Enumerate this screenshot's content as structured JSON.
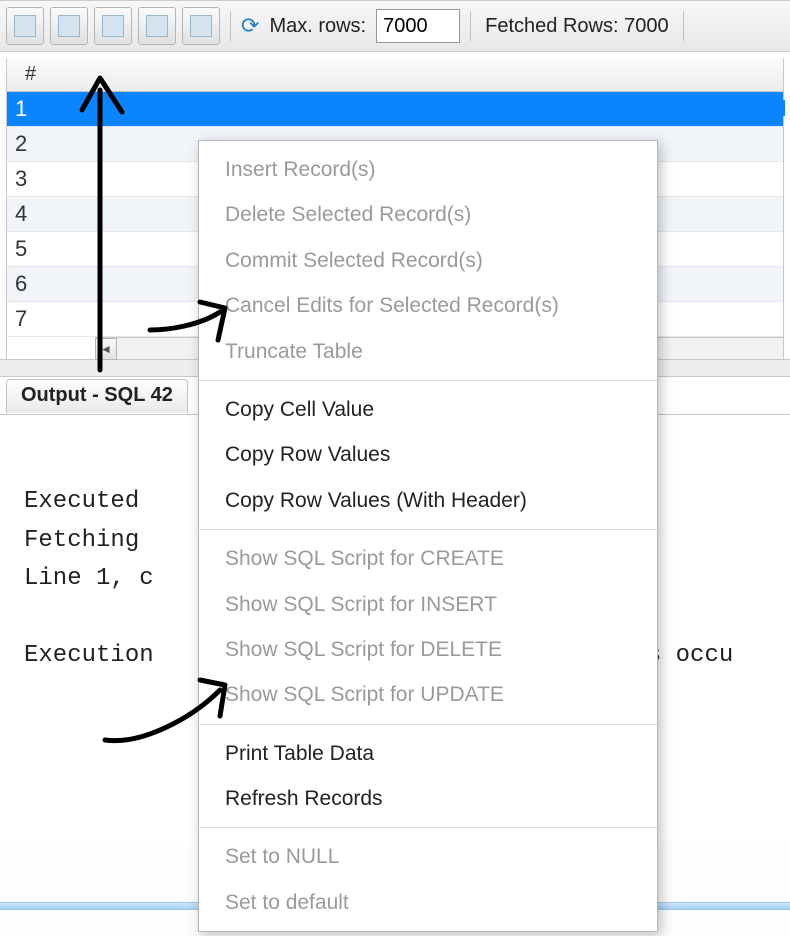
{
  "toolbar": {
    "max_rows_label": "Max. rows:",
    "max_rows_value": "7000",
    "fetched_label": "Fetched Rows:  7000"
  },
  "grid": {
    "header": "#",
    "rows": [
      "1",
      "2",
      "3",
      "4",
      "5",
      "6",
      "7"
    ]
  },
  "output_tab": "Output - SQL 42",
  "output_lines": [
    "Executed",
    "Fetching",
    "Line 1, c",
    "",
    "Execution"
  ],
  "output_tail": "rors occu",
  "context_menu": {
    "group1": [
      "Insert Record(s)",
      "Delete Selected Record(s)",
      "Commit Selected Record(s)",
      "Cancel Edits for Selected Record(s)",
      "Truncate Table"
    ],
    "group2": [
      "Copy Cell Value",
      "Copy Row Values",
      "Copy Row Values (With Header)"
    ],
    "group3": [
      "Show SQL Script for CREATE",
      "Show SQL Script for INSERT",
      "Show SQL Script for DELETE",
      "Show SQL Script for UPDATE"
    ],
    "group4": [
      "Print Table Data",
      "Refresh Records"
    ],
    "group5": [
      "Set to NULL",
      "Set to default"
    ]
  }
}
